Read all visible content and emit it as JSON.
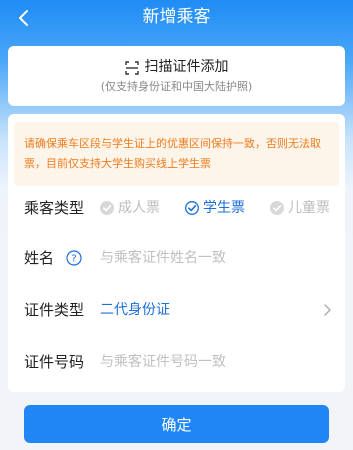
{
  "header": {
    "title": "新增乘客"
  },
  "scan": {
    "label": "扫描证件添加",
    "hint": "(仅支持身份证和中国大陆护照)"
  },
  "notice": {
    "text": "请确保乘车区段与学生证上的优惠区间保持一致，否则无法取票，目前仅支持大学生购买线上学生票"
  },
  "form": {
    "passenger_type": {
      "label": "乘客类型",
      "options": [
        {
          "label": "成人票",
          "selected": false
        },
        {
          "label": "学生票",
          "selected": true
        },
        {
          "label": "儿童票",
          "selected": false
        }
      ]
    },
    "name": {
      "label": "姓名",
      "placeholder": "与乘客证件姓名一致"
    },
    "id_type": {
      "label": "证件类型",
      "value": "二代身份证"
    },
    "id_number": {
      "label": "证件号码",
      "placeholder": "与乘客证件号码一致"
    }
  },
  "confirm": {
    "label": "确定"
  },
  "colors": {
    "primary": "#1f86f4",
    "notice_text": "#f07a1c",
    "notice_bg": "#fdf5ea",
    "selected": "#1a6fd8"
  }
}
